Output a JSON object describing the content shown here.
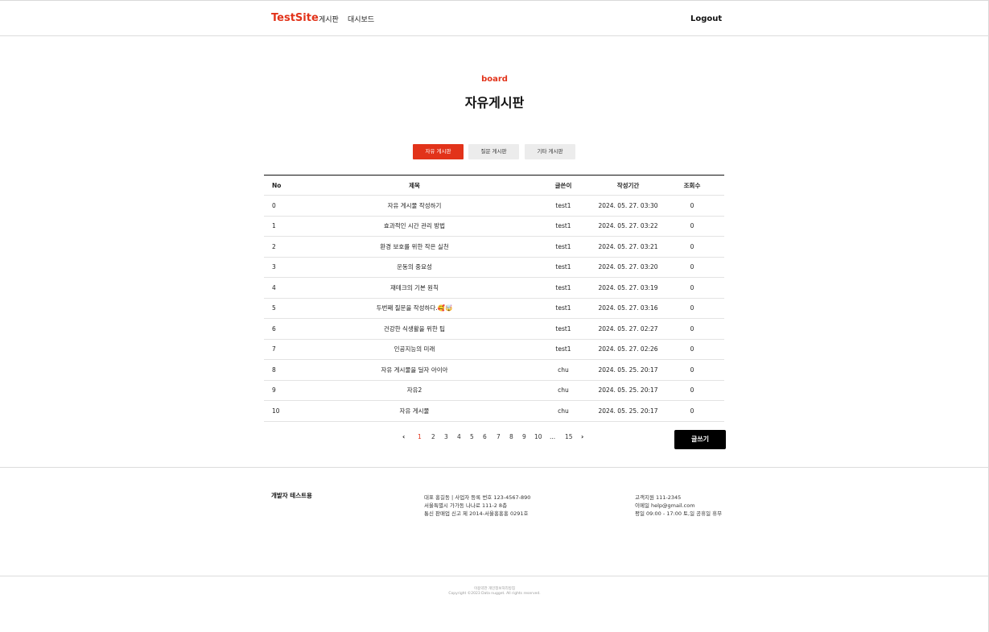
{
  "header": {
    "logo": "TestSite",
    "nav": [
      "게시판",
      "대시보드"
    ],
    "logout": "Logout"
  },
  "hero": {
    "eyebrow": "board",
    "title": "자유게시판"
  },
  "tabs": [
    {
      "label": "자유 게시판",
      "active": true
    },
    {
      "label": "질문 게시판",
      "active": false
    },
    {
      "label": "기타 게시판",
      "active": false
    }
  ],
  "table": {
    "columns": [
      "No",
      "제목",
      "글쓴이",
      "작성기간",
      "조회수"
    ],
    "rows": [
      {
        "no": "0",
        "title": "자유 게시물 작성하기",
        "author": "test1",
        "date": "2024. 05. 27. 03:30",
        "views": "0"
      },
      {
        "no": "1",
        "title": "효과적인 시간 관리 방법",
        "author": "test1",
        "date": "2024. 05. 27. 03:22",
        "views": "0"
      },
      {
        "no": "2",
        "title": "환경 보호를 위한 작은 실천",
        "author": "test1",
        "date": "2024. 05. 27. 03:21",
        "views": "0"
      },
      {
        "no": "3",
        "title": "운동의 중요성",
        "author": "test1",
        "date": "2024. 05. 27. 03:20",
        "views": "0"
      },
      {
        "no": "4",
        "title": "재테크의 기본 원칙",
        "author": "test1",
        "date": "2024. 05. 27. 03:19",
        "views": "0"
      },
      {
        "no": "5",
        "title": "두번째 질문을 작성하다.🥰🤯",
        "author": "test1",
        "date": "2024. 05. 27. 03:16",
        "views": "0"
      },
      {
        "no": "6",
        "title": "건강한 식생활을 위한 팁",
        "author": "test1",
        "date": "2024. 05. 27. 02:27",
        "views": "0"
      },
      {
        "no": "7",
        "title": "인공지능의 미래",
        "author": "test1",
        "date": "2024. 05. 27. 02:26",
        "views": "0"
      },
      {
        "no": "8",
        "title": "자유 게시물을 딜자 아이아",
        "author": "chu",
        "date": "2024. 05. 25. 20:17",
        "views": "0"
      },
      {
        "no": "9",
        "title": "자유2",
        "author": "chu",
        "date": "2024. 05. 25. 20:17",
        "views": "0"
      },
      {
        "no": "10",
        "title": "자유 게시물",
        "author": "chu",
        "date": "2024. 05. 25. 20:17",
        "views": "0"
      }
    ]
  },
  "pagination": {
    "prev_icon": "chevron-left-icon",
    "pages": [
      "1",
      "2",
      "3",
      "4",
      "5",
      "6",
      "7",
      "8",
      "9",
      "10",
      "...",
      "15"
    ],
    "current": "1",
    "next_icon": "chevron-right-icon"
  },
  "write_button": "글쓰기",
  "footer": {
    "brand": "개발자 테스트용",
    "company_lines": [
      "대표 홍길동  |  사업자 등록 번호 123-4567-890",
      "서울특별시 가가동 나나로 111-2 8층",
      "통신 판매업 신고 제 2014-서울홍홍홍 0291호"
    ],
    "contact_lines": [
      "고객지원 111-2345",
      "이메일 help@gmail.com",
      "평일 09:00 - 17:00 토,일 공휴일 휴무"
    ],
    "legal_lines": [
      "이용약관 개인정보처리방침",
      "Copyright ©2023 Data nugget. All rights reserved."
    ]
  },
  "colors": {
    "accent": "#e2331a",
    "dark": "#000000",
    "tab_inactive": "#ececec"
  }
}
